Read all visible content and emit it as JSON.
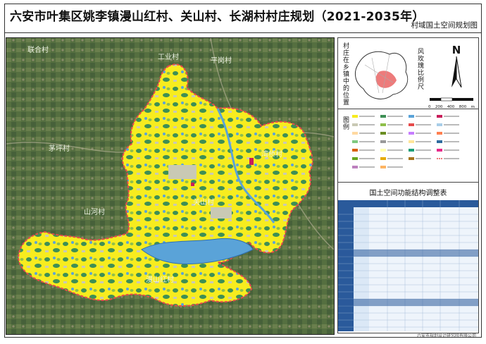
{
  "title": "六安市叶集区姚李镇漫山红村、关山村、长湖村村庄规划（2021-2035年）",
  "subtitle": "村域国土空间规划图",
  "map": {
    "places": [
      "工业村",
      "平岗村",
      "关山村",
      "湾桥村",
      "山河村",
      "漫山红村",
      "茅坪村",
      "联合村"
    ],
    "colors": {
      "agri": "#f7ec1f",
      "forest": "#3e8f55",
      "water": "#5aa3d8",
      "village": "#c9c9b4",
      "boundary": "#e64b4b"
    }
  },
  "sidebar": {
    "location_label": "村庄在乡镇中的位置",
    "legend_label": "图例",
    "compass_letter": "N",
    "scale_label": "风玫瑰比例尺",
    "scale_ticks": [
      "0",
      "200",
      "400",
      "800"
    ],
    "scale_unit": "m",
    "table_title": "国土空间功能结构调整表"
  },
  "footer": "六安市规划设计研究院有限公司"
}
